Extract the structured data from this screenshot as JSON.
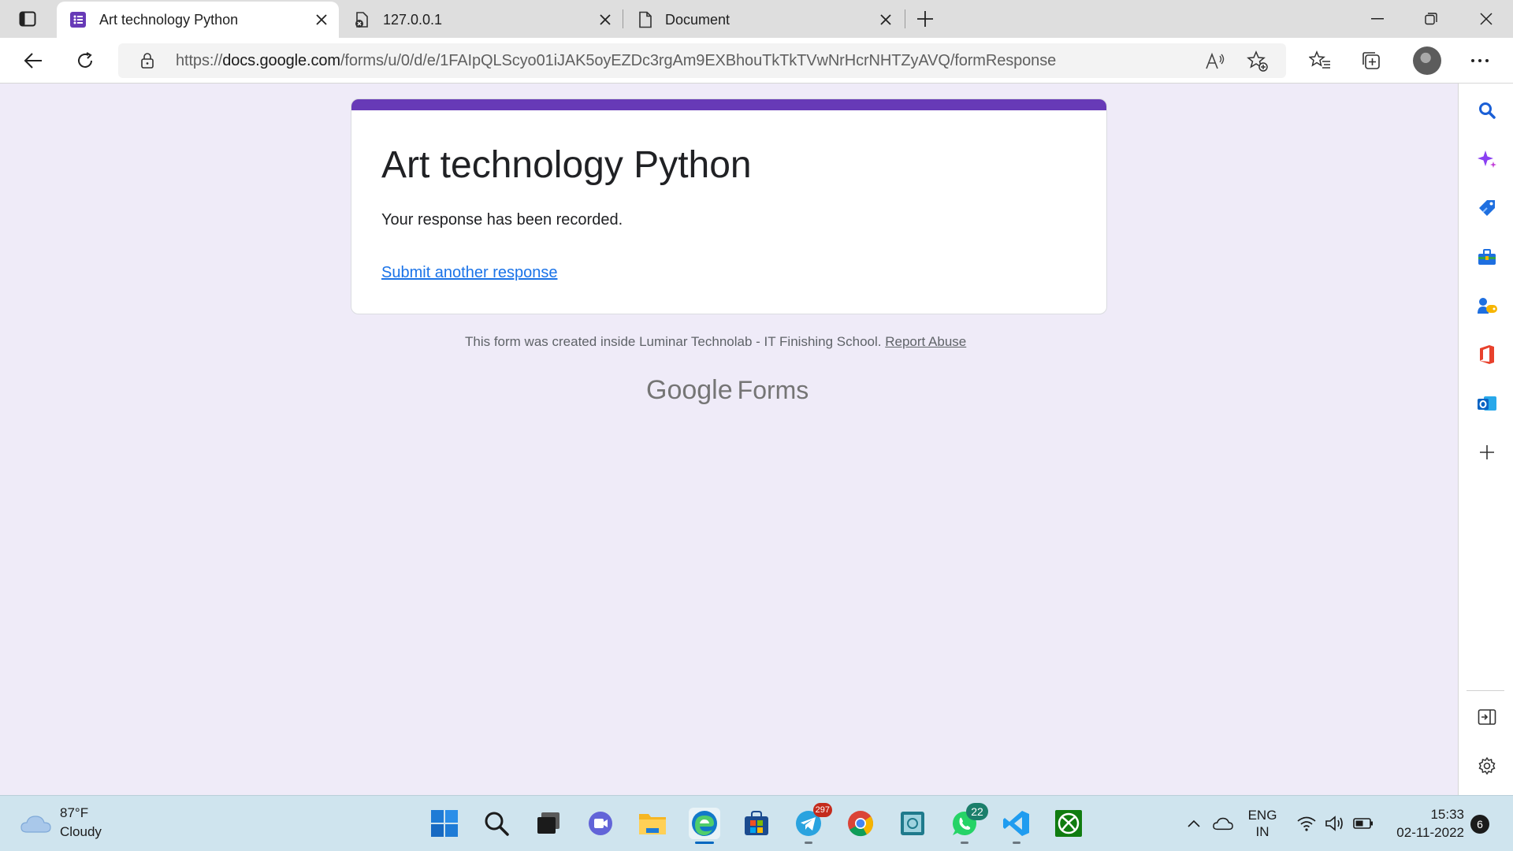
{
  "browser": {
    "tabs": [
      {
        "title": "Art technology Python",
        "icon": "google-forms-icon",
        "active": true
      },
      {
        "title": "127.0.0.1",
        "icon": "page-error-icon",
        "active": false
      },
      {
        "title": "Document",
        "icon": "document-icon",
        "active": false
      }
    ],
    "url_prefix": "https://",
    "url_domain": "docs.google.com",
    "url_path": "/forms/u/0/d/e/1FAIpQLScyo01iJAK5oyEZDc3rgAm9EXBhouTkTkTVwNrHcrNHTZyAVQ/formResponse"
  },
  "form": {
    "title": "Art technology Python",
    "message": "Your response has been recorded.",
    "link_label": "Submit another response",
    "accent_color": "#673ab7",
    "footer_text": "This form was created inside Luminar Technolab - IT Finishing School. ",
    "report_label": "Report Abuse",
    "logo_google": "Google",
    "logo_forms": "Forms"
  },
  "taskbar": {
    "weather_temp": "87°F",
    "weather_desc": "Cloudy",
    "telegram_badge": "297",
    "whatsapp_badge": "22",
    "lang_line1": "ENG",
    "lang_line2": "IN",
    "time": "15:33",
    "date": "02-11-2022",
    "notifications": "6"
  }
}
